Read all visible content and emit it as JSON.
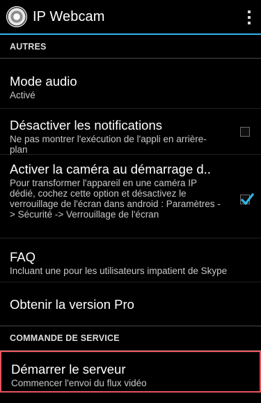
{
  "app": {
    "title": "IP Webcam"
  },
  "sections": {
    "autres": "AUTRES",
    "commande": "COMMANDE DE SERVICE"
  },
  "prefs": {
    "audio": {
      "title": "Mode audio",
      "summary": "Activé"
    },
    "notifications": {
      "title": "Désactiver les notifications",
      "summary": "Ne pas montrer l'exécution de l'appli en arrière-plan",
      "checked": false
    },
    "camera": {
      "title": "Activer la caméra au démarrage d..",
      "summary": "Pour transformer l'appareil en une caméra IP dédié, cochez cette option et désactivez le verrouillage de l'écran dans android : Paramètres -> Sécurité -> Verrouillage de l'écran",
      "checked": true
    },
    "faq": {
      "title": "FAQ",
      "summary": "Incluant une pour les utilisateurs impatient de Skype"
    },
    "pro": {
      "title": "Obtenir la version Pro"
    },
    "start": {
      "title": "Démarrer le serveur",
      "summary": "Commencer l'envoi du flux vidéo"
    }
  },
  "icons": {
    "app": "webcam-icon",
    "menu": "overflow-menu-icon",
    "check": "checkmark-icon"
  },
  "colors": {
    "accent": "#33b5e5",
    "highlight": "#e9545c",
    "background": "#000000"
  }
}
